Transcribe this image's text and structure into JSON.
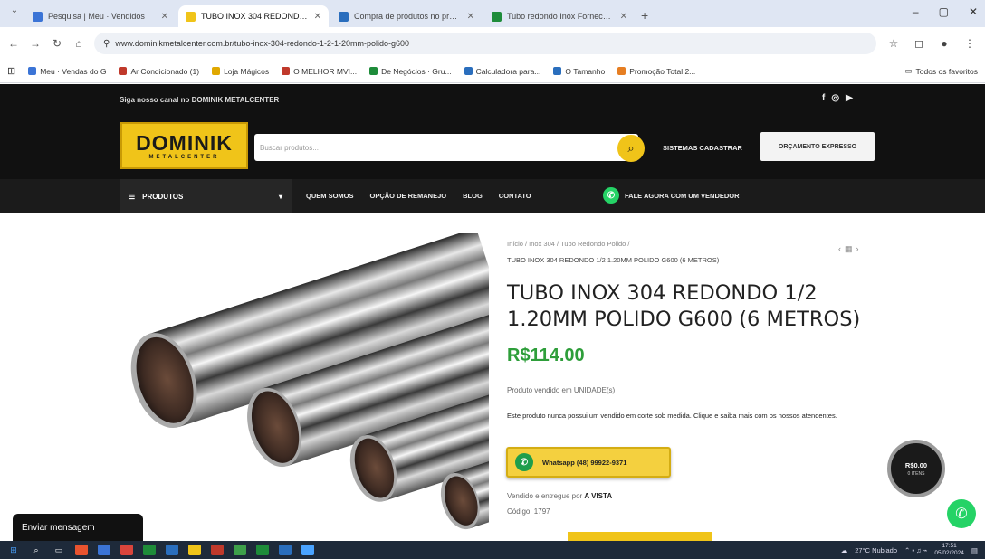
{
  "browser": {
    "tabs": [
      {
        "title": "Pesquisa | Meu · Vendidos",
        "color": "#3b74d6",
        "active": false
      },
      {
        "title": "TUBO INOX 304 REDONDO 1/2",
        "color": "#f0c419",
        "active": true
      },
      {
        "title": "Compra de produtos no preço",
        "color": "#2a6ebd",
        "active": false
      },
      {
        "title": "Tubo redondo Inox Fornecedor",
        "color": "#1e8c3a",
        "active": false
      }
    ],
    "new_tab": "+",
    "window_controls": [
      "–",
      "▢",
      "✕"
    ],
    "url": "www.dominikmetalcenter.com.br/tubo-inox-304-redondo-1-2-1-20mm-polido-g600",
    "bookmarks": [
      {
        "label": "Meu · Vendas do G",
        "color": "#3b74d6"
      },
      {
        "label": "Ar Condicionado (1)",
        "color": "#c0392b"
      },
      {
        "label": "Loja Mágicos",
        "color": "#e0a800"
      },
      {
        "label": "O MELHOR MVI...",
        "color": "#c0392b"
      },
      {
        "label": "De Negócios · Gru...",
        "color": "#1e8c3a"
      },
      {
        "label": "Calculadora para...",
        "color": "#2a6ebd"
      },
      {
        "label": "O Tamanho",
        "color": "#2a6ebd"
      },
      {
        "label": "Promoção Total 2...",
        "color": "#e67e22"
      }
    ],
    "bookmarks_other": "Todos os favoritos"
  },
  "site": {
    "promo": "Siga nosso canal no DOMINIK METALCENTER",
    "social": [
      "f",
      "◎",
      "▶"
    ],
    "logo": {
      "name": "DOMINIK",
      "tagline": "METALCENTER"
    },
    "search_placeholder": "Buscar produtos...",
    "systems_link": "SISTEMAS CADASTRAR",
    "quote_button": "ORÇAMENTO EXPRESSO",
    "nav": {
      "products": "PRODUTOS",
      "links": [
        "QUEM SOMOS",
        "OPÇÃO DE REMANEJO",
        "BLOG",
        "CONTATO"
      ],
      "whatsapp": "FALE AGORA COM UM VENDEDOR"
    }
  },
  "product": {
    "breadcrumb": "Início / Inox 304 / Tubo Redondo Polido /",
    "breadcrumb_current": "TUBO INOX 304 REDONDO 1/2 1.20MM POLIDO G600 (6 METROS)",
    "prod_nav": [
      "‹",
      "▦",
      "›"
    ],
    "title": "TUBO INOX 304 REDONDO 1/2 1.20MM POLIDO G600 (6 METROS)",
    "price": "R$114.00",
    "stock": "Produto vendido em UNIDADE(s)",
    "description": "Este produto nunca possui um vendido em corte sob medida. Clique e saiba mais com os nossos atendentes.",
    "whatsapp_button": "Whatsapp (48) 99922-9371",
    "seller_prefix": "Vendido e entregue por",
    "seller_name": "A VISTA",
    "code": "Código: 1797"
  },
  "floating": {
    "cart_value": "R$0.00",
    "cart_sub": "0 ITENS",
    "chat_label": "Enviar mensagem"
  },
  "taskbar": {
    "weather": "27°C Nublado",
    "time": "17:51",
    "date": "05/02/2024"
  }
}
